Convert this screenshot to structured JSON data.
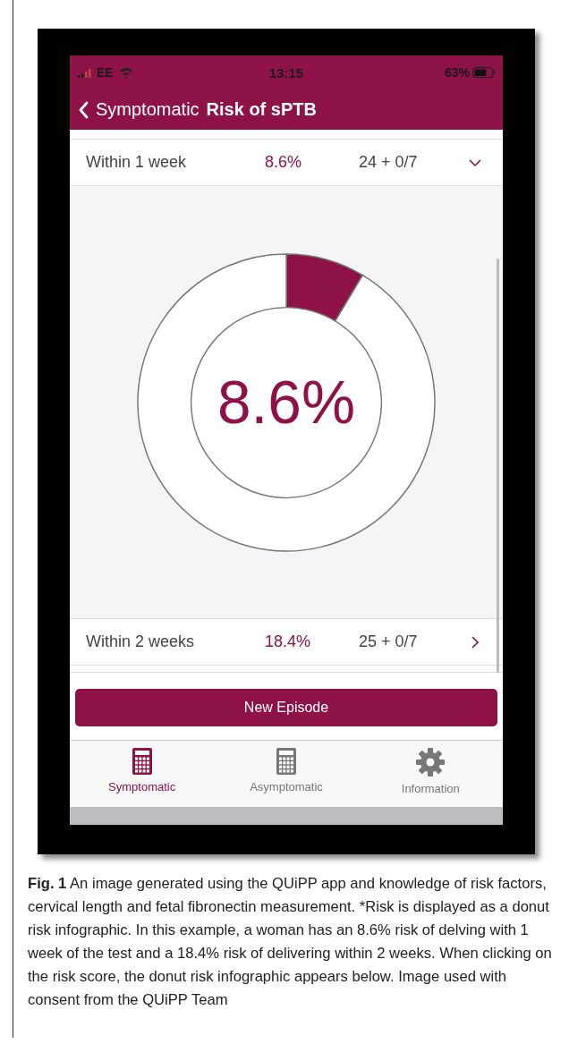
{
  "status_bar": {
    "carrier": "EE",
    "time": "13:15",
    "battery": "63%"
  },
  "nav_bar": {
    "back_label": "Symptomatic",
    "title": "Risk of sPTB"
  },
  "risk_rows": [
    {
      "label": "Within 1 week",
      "risk": "8.6%",
      "gestation": "24 + 0/7",
      "expanded": true
    },
    {
      "label": "Within 2 weeks",
      "risk": "18.4%",
      "gestation": "25 + 0/7",
      "expanded": false
    }
  ],
  "donut": {
    "chart_data": {
      "type": "donut",
      "values": [
        8.6,
        91.4
      ]
    },
    "label": "8.6%"
  },
  "button": "New Episode",
  "tab_bar": [
    {
      "label": "Symptomatic",
      "kind": "calculator",
      "selected": true
    },
    {
      "label": "Asymptomatic",
      "kind": "calculator",
      "selected": false
    },
    {
      "label": "Information",
      "kind": "gear",
      "selected": false
    }
  ],
  "caption": "**Fig. 1**  An image generated using the QUiPP app and knowledge of risk factors, cervical length and fetal fibronectin measurement. *Risk is displayed as a donut risk infographic. In this example, a woman has an 8.6% risk of delving with 1 week of the test and a 18.4% risk of delivering within 2 weeks. When clicking on the risk score, the donut risk infographic appears below. Image used with consent from the QUiPP Team"
}
